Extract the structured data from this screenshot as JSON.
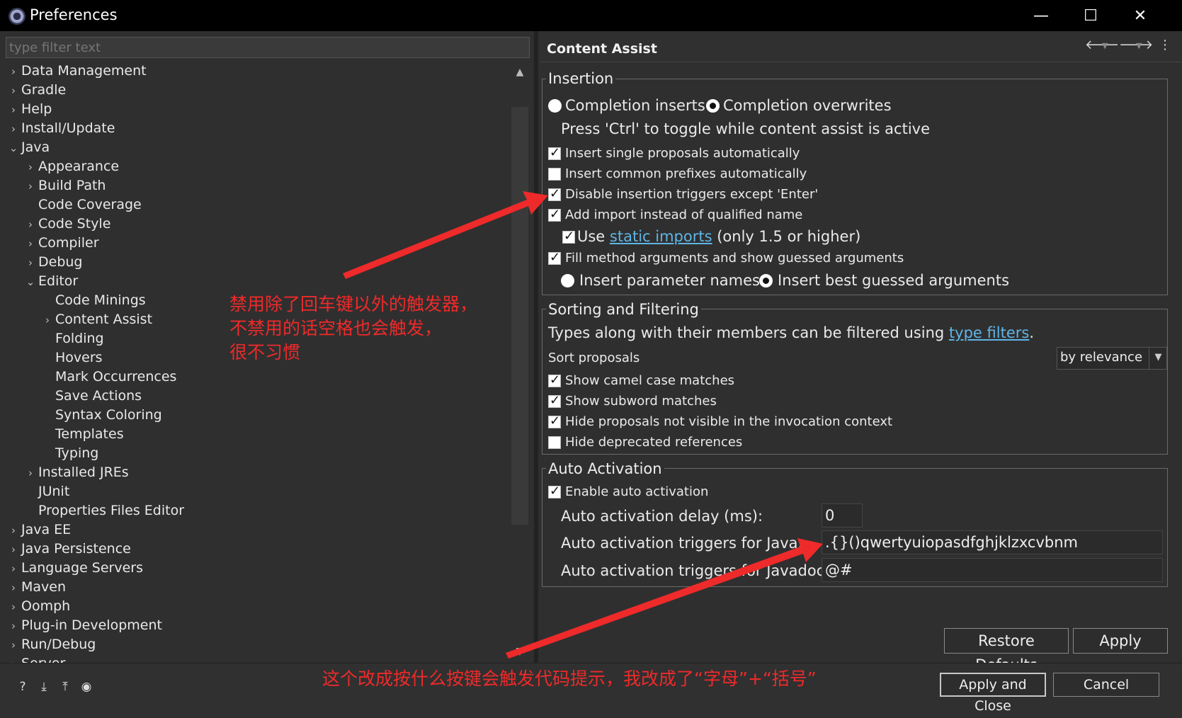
{
  "window": {
    "title": "Preferences",
    "minimize": "—",
    "maximize": "☐",
    "close": "✕"
  },
  "filter": {
    "placeholder": "type filter text"
  },
  "tree": [
    {
      "label": "Data Management",
      "chev": "›",
      "indent": 0
    },
    {
      "label": "Gradle",
      "chev": "›",
      "indent": 0
    },
    {
      "label": "Help",
      "chev": "›",
      "indent": 0
    },
    {
      "label": "Install/Update",
      "chev": "›",
      "indent": 0
    },
    {
      "label": "Java",
      "chev": "⌄",
      "indent": 0
    },
    {
      "label": "Appearance",
      "chev": "›",
      "indent": 1
    },
    {
      "label": "Build Path",
      "chev": "›",
      "indent": 1
    },
    {
      "label": "Code Coverage",
      "chev": "",
      "indent": 1
    },
    {
      "label": "Code Style",
      "chev": "›",
      "indent": 1
    },
    {
      "label": "Compiler",
      "chev": "›",
      "indent": 1
    },
    {
      "label": "Debug",
      "chev": "›",
      "indent": 1
    },
    {
      "label": "Editor",
      "chev": "⌄",
      "indent": 1
    },
    {
      "label": "Code Minings",
      "chev": "",
      "indent": 2
    },
    {
      "label": "Content Assist",
      "chev": "›",
      "indent": 2
    },
    {
      "label": "Folding",
      "chev": "",
      "indent": 2
    },
    {
      "label": "Hovers",
      "chev": "",
      "indent": 2
    },
    {
      "label": "Mark Occurrences",
      "chev": "",
      "indent": 2
    },
    {
      "label": "Save Actions",
      "chev": "",
      "indent": 2
    },
    {
      "label": "Syntax Coloring",
      "chev": "",
      "indent": 2
    },
    {
      "label": "Templates",
      "chev": "",
      "indent": 2
    },
    {
      "label": "Typing",
      "chev": "",
      "indent": 2
    },
    {
      "label": "Installed JREs",
      "chev": "›",
      "indent": 1
    },
    {
      "label": "JUnit",
      "chev": "",
      "indent": 1
    },
    {
      "label": "Properties Files Editor",
      "chev": "",
      "indent": 1
    },
    {
      "label": "Java EE",
      "chev": "›",
      "indent": 0
    },
    {
      "label": "Java Persistence",
      "chev": "›",
      "indent": 0
    },
    {
      "label": "Language Servers",
      "chev": "›",
      "indent": 0
    },
    {
      "label": "Maven",
      "chev": "›",
      "indent": 0
    },
    {
      "label": "Oomph",
      "chev": "›",
      "indent": 0
    },
    {
      "label": "Plug-in Development",
      "chev": "›",
      "indent": 0
    },
    {
      "label": "Run/Debug",
      "chev": "›",
      "indent": 0
    },
    {
      "label": "Server",
      "chev": "›",
      "indent": 0
    }
  ],
  "page": {
    "title": "Content Assist"
  },
  "insertion": {
    "title": "Insertion",
    "completion_inserts": "Completion inserts",
    "completion_overwrites": "Completion overwrites",
    "toggle_hint": "Press 'Ctrl' to toggle while content assist is active",
    "single_proposals": "Insert single proposals automatically",
    "common_prefixes": "Insert common prefixes automatically",
    "disable_triggers": "Disable insertion triggers except 'Enter'",
    "add_import": "Add import instead of qualified name",
    "use": "Use",
    "static_imports": "static imports",
    "only_15": "(only 1.5 or higher)",
    "fill_method": "Fill method arguments and show guessed arguments",
    "insert_param_names": "Insert parameter names",
    "insert_best_guessed": "Insert best guessed arguments"
  },
  "sorting": {
    "title": "Sorting and Filtering",
    "types_text": "Types along with their members can be filtered using",
    "type_filters": "type filters",
    "period": ".",
    "sort_proposals": "Sort proposals",
    "sort_value": "by relevance",
    "camel_case": "Show camel case matches",
    "subword": "Show subword matches",
    "hide_not_visible": "Hide proposals not visible in the invocation context",
    "hide_deprecated": "Hide deprecated references"
  },
  "auto_activation": {
    "title": "Auto Activation",
    "enable": "Enable auto activation",
    "delay_label": "Auto activation delay (ms):",
    "delay_value": "0",
    "java_label": "Auto activation triggers for Java:",
    "java_value": ".{}()qwertyuiopasdfghjklzxcvbnm",
    "javadoc_label": "Auto activation triggers for Javadoc:",
    "javadoc_value": "@#"
  },
  "buttons": {
    "restore_defaults": "Restore Defaults",
    "apply": "Apply",
    "apply_close": "Apply and Close",
    "cancel": "Cancel"
  },
  "annotations": {
    "line1": "禁用除了回车键以外的触发器，",
    "line2": "不禁用的话空格也会触发，",
    "line3": "很不习惯",
    "bottom": "这个改成按什么按键会触发代码提示，我改成了“字母”+“括号”"
  },
  "colors": {
    "annotation": "#ee2a2a",
    "link": "#5fb5e6",
    "background": "#2f2f2f"
  }
}
